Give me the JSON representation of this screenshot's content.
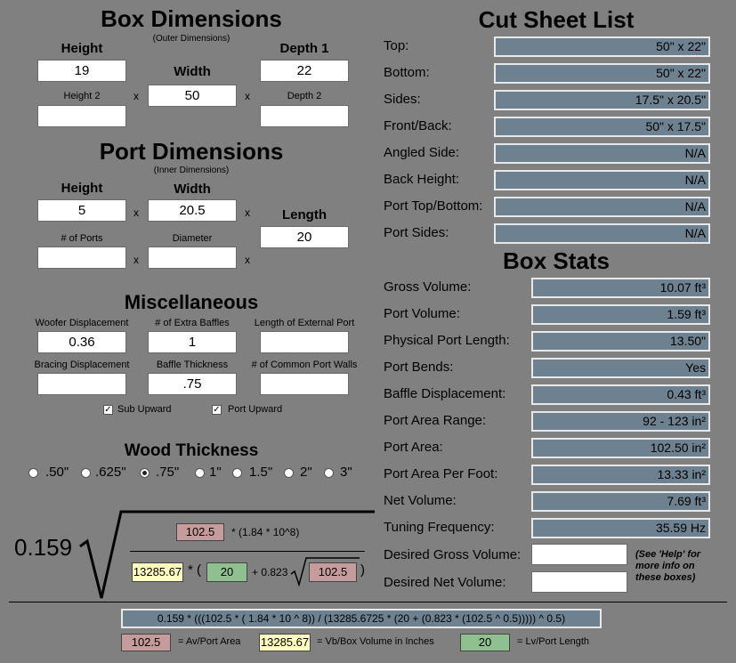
{
  "box_dimensions": {
    "title": "Box Dimensions",
    "subtitle": "(Outer Dimensions)",
    "height_label": "Height",
    "width_label": "Width",
    "depth1_label": "Depth 1",
    "height2_label": "Height 2",
    "depth2_label": "Depth 2",
    "height_value": "19",
    "width_value": "50",
    "depth1_value": "22",
    "height2_value": "",
    "depth2_value": "",
    "x": "x"
  },
  "port_dimensions": {
    "title": "Port Dimensions",
    "subtitle": "(Inner Dimensions)",
    "height_label": "Height",
    "width_label": "Width",
    "length_label": "Length",
    "ports_label": "# of Ports",
    "diameter_label": "Diameter",
    "height_value": "5",
    "width_value": "20.5",
    "length_value": "20",
    "ports_value": "",
    "diameter_value": ""
  },
  "misc": {
    "title": "Miscellaneous",
    "woofer_label": "Woofer Displacement",
    "baffles_label": "# of Extra Baffles",
    "ext_port_label": "Length of External Port",
    "bracing_label": "Bracing Displacement",
    "baffle_thick_label": "Baffle Thickness",
    "common_walls_label": "# of Common Port Walls",
    "woofer_value": "0.36",
    "baffles_value": "1",
    "ext_port_value": "",
    "bracing_value": "",
    "baffle_thick_value": ".75",
    "common_walls_value": "",
    "sub_upward_label": "Sub Upward",
    "port_upward_label": "Port Upward",
    "check_mark": "✓"
  },
  "wood": {
    "title": "Wood Thickness",
    "options": [
      ".50\"",
      ".625\"",
      ".75\"",
      "1\"",
      "1.5\"",
      "2\"",
      "3\""
    ],
    "selected": ".75\""
  },
  "formula": {
    "coef": "0.159",
    "av": "102.5",
    "numerator_rest": "* (1.84 * 10^8)",
    "vb": "13285.67",
    "star_paren": "* (",
    "lv": "20",
    "plus": "+ 0.823",
    "av2": "102.5",
    "close": ")"
  },
  "cut_sheet": {
    "title": "Cut Sheet List",
    "rows": [
      {
        "label": "Top:",
        "value": "50\" x 22\""
      },
      {
        "label": "Bottom:",
        "value": "50\" x 22\""
      },
      {
        "label": "Sides:",
        "value": "17.5\" x 20.5\""
      },
      {
        "label": "Front/Back:",
        "value": "50\" x 17.5\""
      },
      {
        "label": "Angled Side:",
        "value": "N/A"
      },
      {
        "label": "Back Height:",
        "value": "N/A"
      },
      {
        "label": "Port Top/Bottom:",
        "value": "N/A"
      },
      {
        "label": "Port Sides:",
        "value": "N/A"
      }
    ]
  },
  "box_stats": {
    "title": "Box Stats",
    "rows": [
      {
        "label": "Gross Volume:",
        "value": "10.07 ft³"
      },
      {
        "label": "Port Volume:",
        "value": "1.59 ft³"
      },
      {
        "label": "Physical Port Length:",
        "value": "13.50\""
      },
      {
        "label": "Port Bends:",
        "value": "Yes"
      },
      {
        "label": "Baffle Displacement:",
        "value": "0.43 ft³"
      },
      {
        "label": "Port Area Range:",
        "value": "92 - 123 in²"
      },
      {
        "label": "Port Area:",
        "value": "102.50 in²"
      },
      {
        "label": "Port Area Per Foot:",
        "value": "13.33 in²"
      },
      {
        "label": "Net Volume:",
        "value": "7.69 ft³"
      },
      {
        "label": "Tuning Frequency:",
        "value": "35.59 Hz"
      }
    ],
    "desired_gross_label": "Desired Gross Volume:",
    "desired_net_label": "Desired Net Volume:",
    "desired_gross_value": "",
    "desired_net_value": "",
    "help_note": "(See 'Help' for more info on these boxes)"
  },
  "bottom": {
    "expression": "0.159 * (((102.5 * ( 1.84 * 10 ^ 8)) / (13285.6725 * (20 + (0.823 * (102.5 ^ 0.5))))) ^ 0.5)",
    "legend_av_value": "102.5",
    "legend_av_label": "= Av/Port Area",
    "legend_vb_value": "13285.67",
    "legend_vb_label": "= Vb/Box Volume in Inches",
    "legend_lv_value": "20",
    "legend_lv_label": "= Lv/Port Length"
  }
}
